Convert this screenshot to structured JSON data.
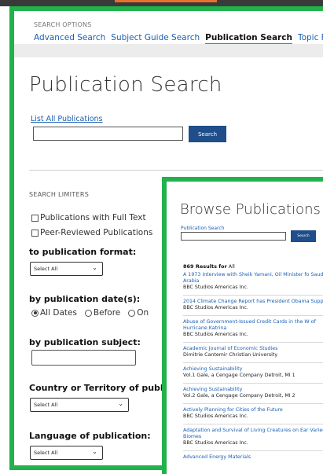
{
  "search_options": {
    "label": "SEARCH OPTIONS",
    "tabs": [
      {
        "label": "Advanced Search"
      },
      {
        "label": "Subject Guide Search"
      },
      {
        "label": "Publication Search"
      },
      {
        "label": "Topic Finder"
      }
    ]
  },
  "publication_search": {
    "title": "Publication Search",
    "list_all_link": "List All Publications",
    "search_value": "",
    "search_button": "Search"
  },
  "limiters": {
    "label": "SEARCH LIMITERS",
    "checkboxes": [
      {
        "label": "Publications with Full Text",
        "checked": false
      },
      {
        "label": "Peer-Reviewed Publications",
        "checked": false
      }
    ],
    "format_heading": "to publication format:",
    "format_select": "Select All",
    "date_heading": "by publication date(s):",
    "date_options": [
      {
        "label": "All Dates",
        "selected": true
      },
      {
        "label": "Before",
        "selected": false
      },
      {
        "label": "On",
        "selected": false
      }
    ],
    "subject_heading": "by publication subject:",
    "subject_value": "",
    "country_heading": "Country or Territory of publication",
    "country_select": "Select All",
    "language_heading": "Language of publication:",
    "language_select": "Select All"
  },
  "browse": {
    "title": "Browse Publications",
    "search_label": "Publication Search",
    "search_button": "Search",
    "results_count": "869 Results for",
    "results_query": "All",
    "items": [
      {
        "title": "A 1973 Interview with Sheik Yamani, Oil Minister fo Saudi Arabia",
        "publisher": "BBC Studios Americas Inc."
      },
      {
        "title": "2014 Climate Change Report has President Obama Support",
        "publisher": "BBC Studios Americas Inc."
      },
      {
        "title": "Abuse of Government-Issued Credit Cards in the W of Hurricane Katrina",
        "publisher": "BBC Studios Americas Inc."
      },
      {
        "title": "Academic Journal of Economic Studies",
        "publisher": "Dimitrie Cantemir Christian University"
      },
      {
        "title": "Achieving Sustainability",
        "publisher": "Vol.1 Gale, a Cengage Company Detroit, MI 1"
      },
      {
        "title": "Achieving Sustainability",
        "publisher": "Vol.2 Gale, a Cengage Company Detroit, MI 2"
      },
      {
        "title": "Actively Planning for Cities of the Future",
        "publisher": "BBC Studios Americas Inc."
      },
      {
        "title": "Adaptation and Survival of Living Creatures on Ear Varied Biomes",
        "publisher": "BBC Studios Americas Inc."
      },
      {
        "title": "Advanced Energy Materials",
        "publisher": ""
      }
    ]
  },
  "colors": {
    "accent_green": "#21b24b",
    "link_blue": "#1a5fb4",
    "button_navy": "#1f4e8a",
    "tab_underline": "#d94a1e"
  }
}
